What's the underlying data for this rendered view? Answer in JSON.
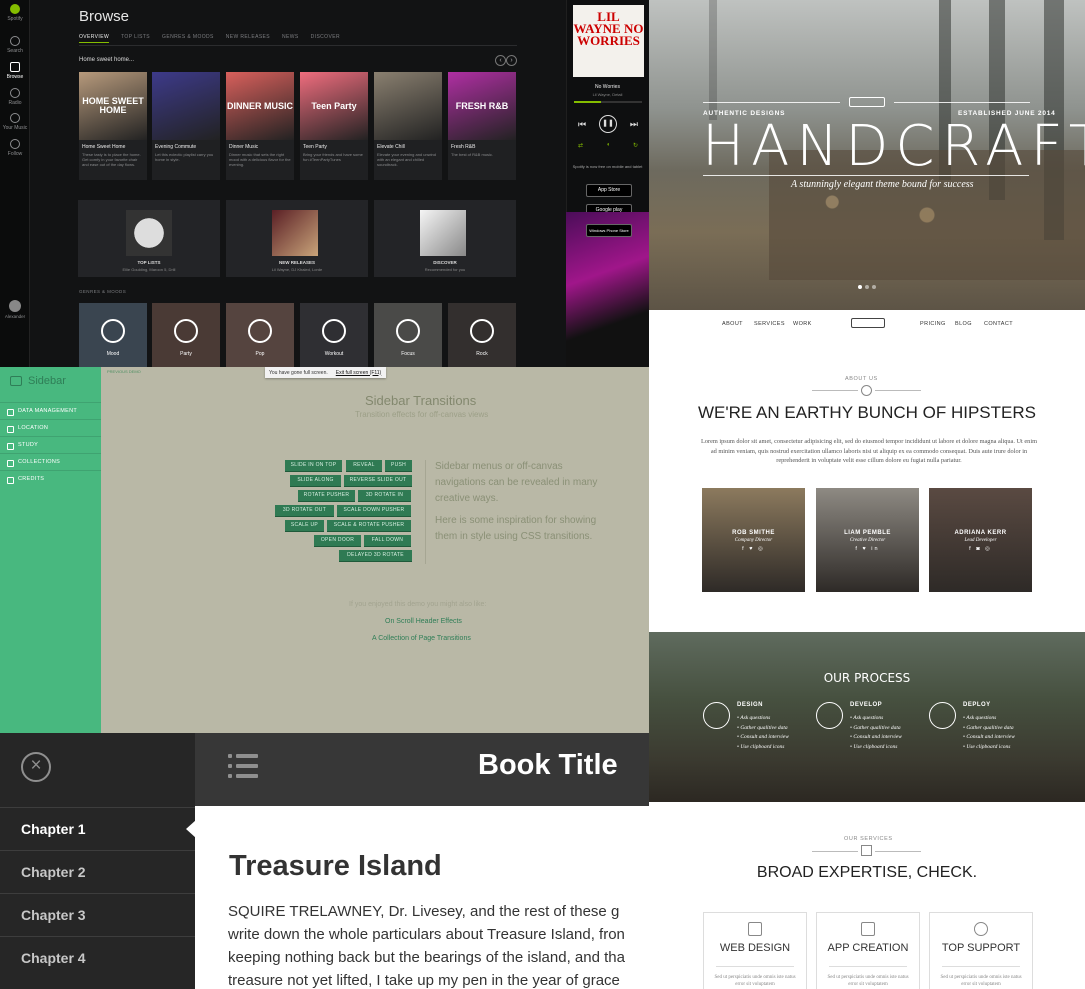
{
  "spotify": {
    "title": "Browse",
    "tabs": [
      "OVERVIEW",
      "TOP LISTS",
      "GENRES & MOODS",
      "NEW RELEASES",
      "NEWS",
      "DISCOVER"
    ],
    "nav": [
      "Spotify",
      "Search",
      "Browse",
      "Radio",
      "Your Music",
      "Follow"
    ],
    "user": "Alexander",
    "section": "Home sweet home...",
    "playlists": [
      {
        "title": "Home Sweet Home",
        "art": "HOME SWEET HOME",
        "color": "#b79a7c",
        "desc": "These tasty is to place the home. Get comfy in your favorite chair and ease out of the day flows."
      },
      {
        "title": "Evening Commute",
        "art": "",
        "color": "#3d3a8a",
        "desc": "Let this eclectic playlist carry you home in style."
      },
      {
        "title": "Dinner Music",
        "art": "DINNER MUSIC",
        "color": "#d9605c",
        "desc": "Dinner music that sets the right mood with a delicious flavor for the evening."
      },
      {
        "title": "Teen Party",
        "art": "Teen Party",
        "color": "#f06d7e",
        "desc": "Bring your friends and have some fun #TeenPartyTunes"
      },
      {
        "title": "Elevate Chill",
        "art": "",
        "color": "#8a8070",
        "desc": "Elevate your evening and unwind with an elegant and chilled soundtrack."
      },
      {
        "title": "Fresh R&B",
        "art": "FRESH R&B",
        "color": "#b02fa3",
        "desc": "The best of R&B music."
      }
    ],
    "features": [
      {
        "title": "TOP LISTS",
        "sub": "Ellie Goulding, Maroon 5, Drill"
      },
      {
        "title": "NEW RELEASES",
        "sub": "Lil Wayne, DJ Khaled, Lorde"
      },
      {
        "title": "DISCOVER",
        "sub": "Recommended for you"
      }
    ],
    "genres_label": "GENRES & MOODS",
    "genres": [
      "Mood",
      "Party",
      "Pop",
      "Workout",
      "Focus",
      "Rock"
    ],
    "now_playing": {
      "album_text": "LIL WAYNE NO WORRIES",
      "song": "No Worries",
      "artist": "Lil Wayne, Detail",
      "progress": 0.4
    },
    "promo": "Spotify is now free on mobile and tablet",
    "stores": [
      "App Store",
      "Google play",
      "Windows Phone Store"
    ]
  },
  "sidebar_demo": {
    "brand": "Sidebar",
    "menu": [
      "DATA MANAGEMENT",
      "LOCATION",
      "STUDY",
      "COLLECTIONS",
      "CREDITS"
    ],
    "prev": "PREVIOUS DEMO",
    "fullscreen_msg": "You have gone full screen.",
    "fullscreen_exit": "Exit full screen (F11)",
    "title": "Sidebar Transitions",
    "subtitle": "Transition effects for off-canvas views",
    "buttons": [
      "SLIDE IN ON TOP",
      "REVEAL",
      "PUSH",
      "SLIDE ALONG",
      "REVERSE SLIDE OUT",
      "ROTATE PUSHER",
      "3D ROTATE IN",
      "3D ROTATE OUT",
      "SCALE DOWN PUSHER",
      "SCALE UP",
      "SCALE & ROTATE PUSHER",
      "OPEN DOOR",
      "FALL DOWN",
      "DELAYED 3D ROTATE"
    ],
    "desc1": "Sidebar menus or off-canvas navigations can be revealed in many creative ways.",
    "desc2": "Here is some inspiration for showing them in style using CSS transitions.",
    "enjoy": "If you enjoyed this demo you might also like:",
    "link1": "On Scroll Header Effects",
    "link2": "A Collection of Page Transitions"
  },
  "book": {
    "chapters": [
      "Chapter 1",
      "Chapter 2",
      "Chapter 3",
      "Chapter 4"
    ],
    "active_chapter": 0,
    "title": "Book Title",
    "heading": "Treasure Island",
    "lines": [
      "SQUIRE TRELAWNEY, Dr. Livesey, and the rest of these g",
      "write down the whole particulars about Treasure Island, fron",
      "keeping nothing back but the bearings of the island, and tha",
      "treasure not yet lifted, I take up my pen in the year of grace"
    ]
  },
  "handcrafted": {
    "authentic": "AUTHENTIC DESIGNS",
    "established": "ESTABLISHED JUNE 2014",
    "title": "HANDCRAFTED",
    "tagline": "A stunningly elegant theme bound for success",
    "nav_left": [
      "ABOUT",
      "SERVICES",
      "WORK"
    ],
    "nav_right": [
      "PRICING",
      "BLOG",
      "CONTACT"
    ],
    "about_label": "ABOUT US",
    "about_heading": "WE'RE AN EARTHY BUNCH OF HIPSTERS",
    "about_text": "Lorem ipsum dolor sit amet, consectetur adipisicing elit, sed do eiusmod tempor incididunt ut labore et dolore magna aliqua. Ut enim ad minim veniam, quis nostrud exercitation ullamco laboris nisi ut aliquip ex ea commodo consequat. Duis aute irure dolor in reprehenderit in voluptate velit esse cillum dolore eu fugiat nulla pariatur.",
    "team": [
      {
        "name": "ROB SMITHE",
        "role": "Company Director",
        "social": "f ♥ ◎",
        "color": "#8c7a5e"
      },
      {
        "name": "LIAM PEMBLE",
        "role": "Creative Director",
        "social": "f ♥ in",
        "color": "#8e8a83"
      },
      {
        "name": "ADRIANA KERR",
        "role": "Lead Developer",
        "social": "f ◙ ◎",
        "color": "#5a4a42"
      }
    ],
    "process_title": "OUR PROCESS",
    "steps": [
      {
        "title": "DESIGN",
        "items": [
          "Ask questions",
          "Gather qualitive data",
          "Consult and interview",
          "Use clipboard icons"
        ]
      },
      {
        "title": "DEVELOP",
        "items": [
          "Ask questions",
          "Gather qualitive data",
          "Consult and interview",
          "Use clipboard icons"
        ]
      },
      {
        "title": "DEPLOY",
        "items": [
          "Ask questions",
          "Gather qualitive data",
          "Consult and interview",
          "Use clipboard icons"
        ]
      }
    ],
    "services_label": "OUR SERVICES",
    "services_heading": "BROAD EXPERTISE, CHECK.",
    "services": [
      {
        "title": "WEB DESIGN",
        "desc": "Sed ut perspiciatis unde omnis iste natus error sit voluptatem"
      },
      {
        "title": "APP CREATION",
        "desc": "Sed ut perspiciatis unde omnis iste natus error sit voluptatem"
      },
      {
        "title": "TOP SUPPORT",
        "desc": "Sed ut perspiciatis unde omnis iste natus error sit voluptatem"
      }
    ]
  }
}
